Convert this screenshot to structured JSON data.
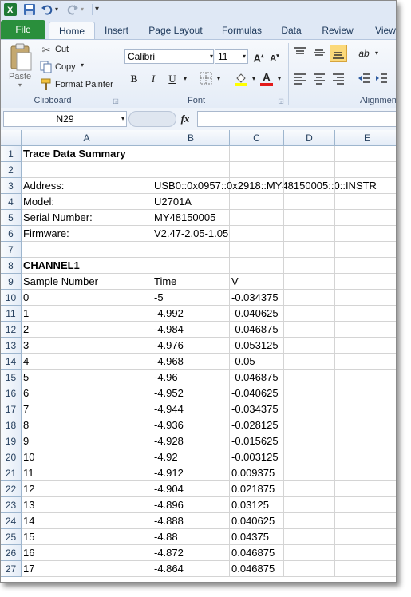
{
  "ribbon": {
    "tabs": [
      "File",
      "Home",
      "Insert",
      "Page Layout",
      "Formulas",
      "Data",
      "Review",
      "View"
    ],
    "clipboard": {
      "paste": "Paste",
      "cut": "Cut",
      "copy": "Copy",
      "format_painter": "Format Painter",
      "label": "Clipboard"
    },
    "font": {
      "name": "Calibri",
      "size": "11",
      "label": "Font"
    },
    "alignment": {
      "label": "Alignment"
    }
  },
  "formula_bar": {
    "name_box": "N29",
    "fx": "fx",
    "content": ""
  },
  "columns": [
    "A",
    "B",
    "C",
    "D",
    "E"
  ],
  "rows": [
    {
      "n": "1",
      "a": "Trace Data Summary",
      "b": "",
      "c": "",
      "bold": true
    },
    {
      "n": "2",
      "a": "",
      "b": "",
      "c": ""
    },
    {
      "n": "3",
      "a": "Address:",
      "b": "USB0::0x0957::0x2918::MY48150005::0::INSTR",
      "c": ""
    },
    {
      "n": "4",
      "a": "Model:",
      "b": "U2701A",
      "c": ""
    },
    {
      "n": "5",
      "a": "Serial Number:",
      "b": "MY48150005",
      "c": ""
    },
    {
      "n": "6",
      "a": "Firmware:",
      "b": "V2.47-2.05-1.05",
      "c": ""
    },
    {
      "n": "7",
      "a": "",
      "b": "",
      "c": ""
    },
    {
      "n": "8",
      "a": "CHANNEL1",
      "b": "",
      "c": "",
      "bold": true
    },
    {
      "n": "9",
      "a": "Sample Number",
      "b": "Time",
      "c": "V"
    },
    {
      "n": "10",
      "a": "0",
      "b": "-5",
      "c": "-0.034375"
    },
    {
      "n": "11",
      "a": "1",
      "b": "-4.992",
      "c": "-0.040625"
    },
    {
      "n": "12",
      "a": "2",
      "b": "-4.984",
      "c": "-0.046875"
    },
    {
      "n": "13",
      "a": "3",
      "b": "-4.976",
      "c": "-0.053125"
    },
    {
      "n": "14",
      "a": "4",
      "b": "-4.968",
      "c": "-0.05"
    },
    {
      "n": "15",
      "a": "5",
      "b": "-4.96",
      "c": "-0.046875"
    },
    {
      "n": "16",
      "a": "6",
      "b": "-4.952",
      "c": "-0.040625"
    },
    {
      "n": "17",
      "a": "7",
      "b": "-4.944",
      "c": "-0.034375"
    },
    {
      "n": "18",
      "a": "8",
      "b": "-4.936",
      "c": "-0.028125"
    },
    {
      "n": "19",
      "a": "9",
      "b": "-4.928",
      "c": "-0.015625"
    },
    {
      "n": "20",
      "a": "10",
      "b": "-4.92",
      "c": "-0.003125"
    },
    {
      "n": "21",
      "a": "11",
      "b": "-4.912",
      "c": "0.009375"
    },
    {
      "n": "22",
      "a": "12",
      "b": "-4.904",
      "c": "0.021875"
    },
    {
      "n": "23",
      "a": "13",
      "b": "-4.896",
      "c": "0.03125"
    },
    {
      "n": "24",
      "a": "14",
      "b": "-4.888",
      "c": "0.040625"
    },
    {
      "n": "25",
      "a": "15",
      "b": "-4.88",
      "c": "0.04375"
    },
    {
      "n": "26",
      "a": "16",
      "b": "-4.872",
      "c": "0.046875"
    },
    {
      "n": "27",
      "a": "17",
      "b": "-4.864",
      "c": "0.046875"
    }
  ]
}
